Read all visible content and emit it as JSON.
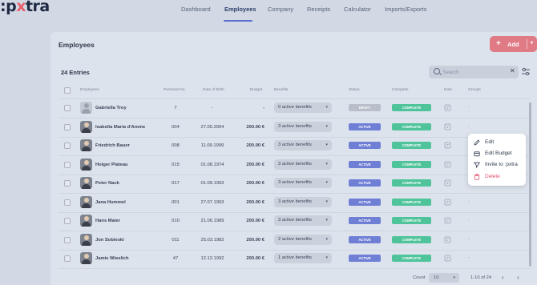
{
  "app": {
    "logo": ":pxtra",
    "nav": [
      "Dashboard",
      "Employees",
      "Company",
      "Receipts",
      "Calculator",
      "Imports/Exports"
    ],
    "active_nav": "Employees"
  },
  "card": {
    "title": "Employees",
    "add_label": "Add",
    "entries_label": "24 Entries",
    "search_placeholder": "Search"
  },
  "table": {
    "headers": [
      "Employees",
      "Personal No.",
      "Date of Birth",
      "Budget",
      "Benefits",
      "Status",
      "Complete",
      "Note",
      "Groups"
    ],
    "rows": [
      {
        "name": "Gabriella Troy",
        "personal_no": "7",
        "dob": "-",
        "budget": "-",
        "benefits": "0 active benefits",
        "status": "DRAFT",
        "complete": "COMPLETE",
        "groups": "-",
        "avatar": "placeholder"
      },
      {
        "name": "Isabella Maria d'Amme",
        "personal_no": "004",
        "dob": "27.05.2004",
        "budget": "200.00 €",
        "benefits": "3 active benefits",
        "status": "ACTIVE",
        "complete": "COMPLETE",
        "groups": "-",
        "avatar": "photo"
      },
      {
        "name": "Friedrich Bauer",
        "personal_no": "008",
        "dob": "11.09.1999",
        "budget": "200.00 €",
        "benefits": "3 active benefits",
        "status": "ACTIVE",
        "complete": "COMPLETE",
        "groups": "",
        "avatar": "photo"
      },
      {
        "name": "Holger Plateau",
        "personal_no": "015",
        "dob": "01.08.1974",
        "budget": "200.00 €",
        "benefits": "3 active benefits",
        "status": "ACTIVE",
        "complete": "COMPLETE",
        "groups": "",
        "avatar": "photo"
      },
      {
        "name": "Peter Nack",
        "personal_no": "017",
        "dob": "01.09.1993",
        "budget": "200.00 €",
        "benefits": "3 active benefits",
        "status": "ACTIVE",
        "complete": "COMPLETE",
        "groups": "",
        "avatar": "photo"
      },
      {
        "name": "Jana Hummel",
        "personal_no": "001",
        "dob": "27.07.1993",
        "budget": "200.00 €",
        "benefits": "3 active benefits",
        "status": "ACTIVE",
        "complete": "COMPLETE",
        "groups": "-",
        "avatar": "photo"
      },
      {
        "name": "Hans Maier",
        "personal_no": "010",
        "dob": "21.06.1989",
        "budget": "200.00 €",
        "benefits": "3 active benefits",
        "status": "ACTIVE",
        "complete": "COMPLETE",
        "groups": "-",
        "avatar": "photo"
      },
      {
        "name": "Jon Sobieski",
        "personal_no": "011",
        "dob": "25.03.1982",
        "budget": "200.00 €",
        "benefits": "2 active benefits",
        "status": "ACTIVE",
        "complete": "COMPLETE",
        "groups": "-",
        "avatar": "photo"
      },
      {
        "name": "Jamie Wieslich",
        "personal_no": "47",
        "dob": "12.12.1992",
        "budget": "200.00 €",
        "benefits": "1 active benefits",
        "status": "ACTIVE",
        "complete": "COMPLETE",
        "groups": "-",
        "avatar": "photo"
      }
    ]
  },
  "context_menu": {
    "items": [
      {
        "label": "Edit",
        "icon": "pencil-icon"
      },
      {
        "label": "Edit Budget",
        "icon": "wallet-icon"
      },
      {
        "label": "Invite to :pxtra",
        "icon": "send-icon"
      },
      {
        "label": "Delete",
        "icon": "trash-icon"
      }
    ]
  },
  "footer": {
    "count_label": "Count",
    "count_value": "10",
    "range": "1-10 of 24",
    "prev": "‹",
    "next": "›"
  },
  "colors": {
    "background": "#d3d9e4",
    "add_button": "#e07b86",
    "status_active": "#6f7fd6",
    "status_draft": "#b8bfcb",
    "complete": "#4fc49b",
    "delete": "#e0506c",
    "nav_underline": "#5b6fd1"
  }
}
